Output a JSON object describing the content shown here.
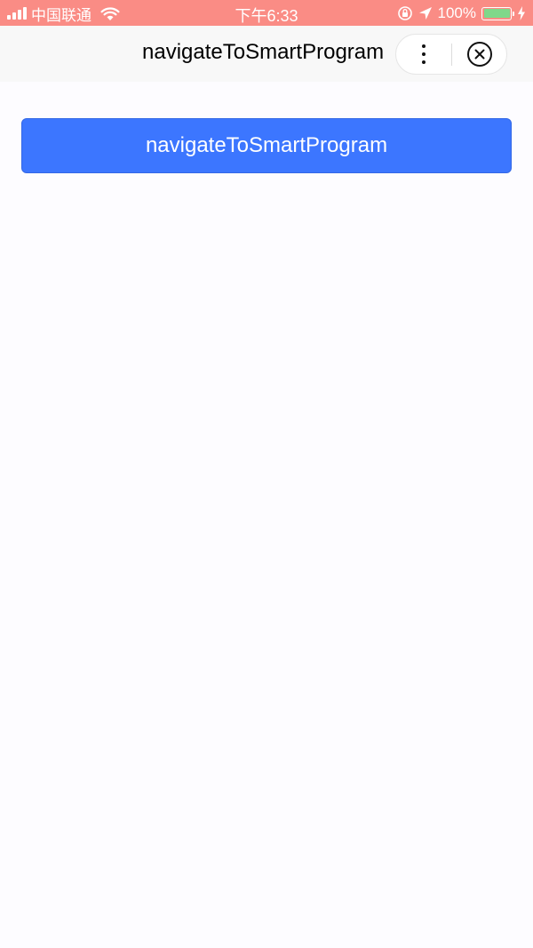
{
  "status_bar": {
    "carrier": "中国联通",
    "time": "下午6:33",
    "battery_percent": "100%",
    "icons": [
      "signal-icon",
      "wifi-icon",
      "orientation-lock-icon",
      "location-icon",
      "battery-icon",
      "charging-icon"
    ],
    "background": "#fa8c85"
  },
  "nav_bar": {
    "title": "navigateToSmartProgram",
    "more_icon": "more-dots-icon",
    "close_icon": "close-circle-icon"
  },
  "main": {
    "button_label": "navigateToSmartProgram",
    "button_color": "#3c76ff"
  }
}
